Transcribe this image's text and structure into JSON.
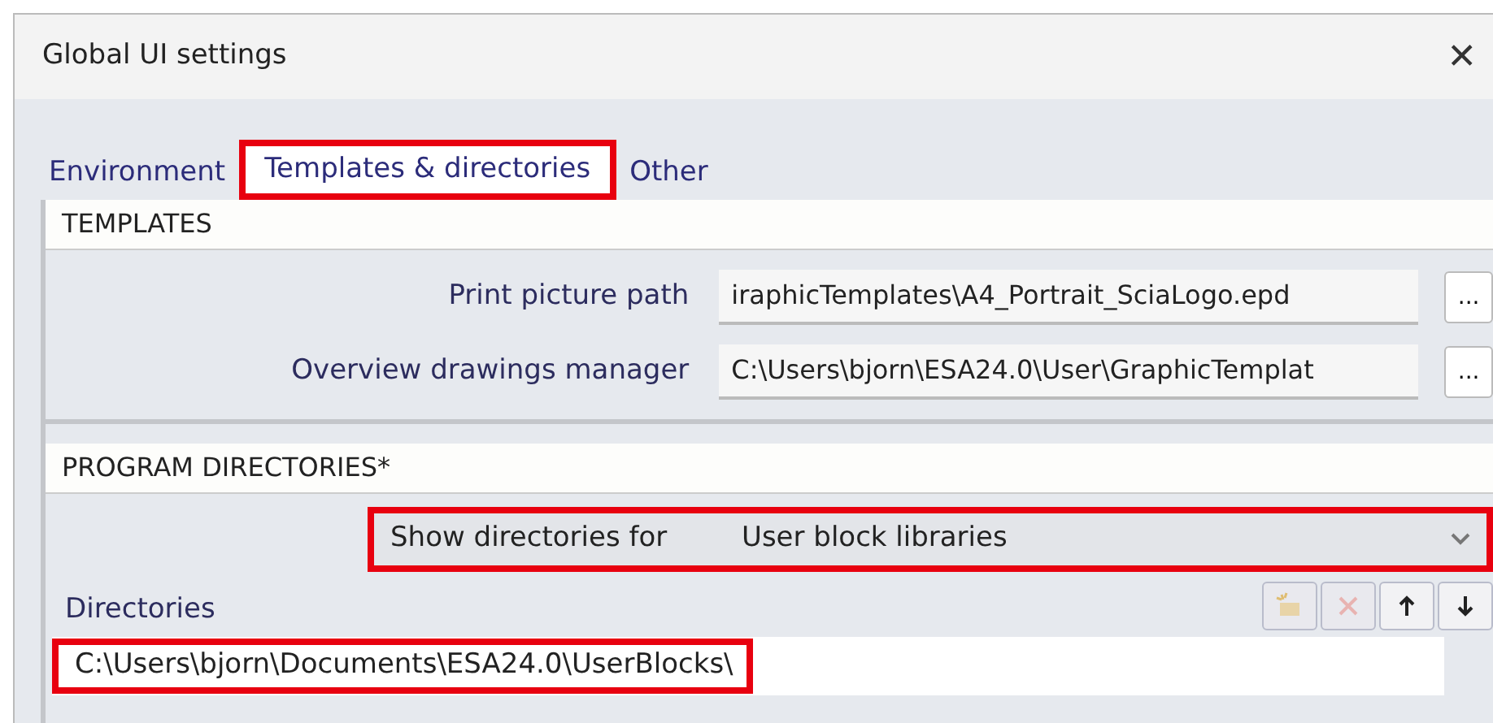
{
  "window": {
    "title": "Global UI settings",
    "close": "✕"
  },
  "tabs": [
    {
      "label": "Environment",
      "selected": false,
      "highlighted": false
    },
    {
      "label": "Templates & directories",
      "selected": true,
      "highlighted": true
    },
    {
      "label": "Other",
      "selected": false,
      "highlighted": false
    }
  ],
  "templates": {
    "header": "TEMPLATES",
    "rows": [
      {
        "label": "Print picture path",
        "value": "iraphicTemplates\\A4_Portrait_SciaLogo.epd",
        "button": "..."
      },
      {
        "label": "Overview drawings manager",
        "value": "C:\\Users\\bjorn\\ESA24.0\\User\\GraphicTemplat",
        "button": "..."
      }
    ]
  },
  "program_directories": {
    "header": "PROGRAM DIRECTORIES*",
    "show_for": {
      "label": "Show directories for",
      "value": "User block libraries",
      "highlighted": true
    },
    "directories_label": "Directories",
    "toolbar": [
      {
        "kind": "add",
        "disabled": true
      },
      {
        "kind": "delete",
        "disabled": true
      },
      {
        "kind": "up",
        "disabled": false
      },
      {
        "kind": "down",
        "disabled": false
      }
    ],
    "directories": [
      {
        "path": "C:\\Users\\bjorn\\Documents\\ESA24.0\\UserBlocks\\",
        "highlighted": true
      }
    ]
  }
}
